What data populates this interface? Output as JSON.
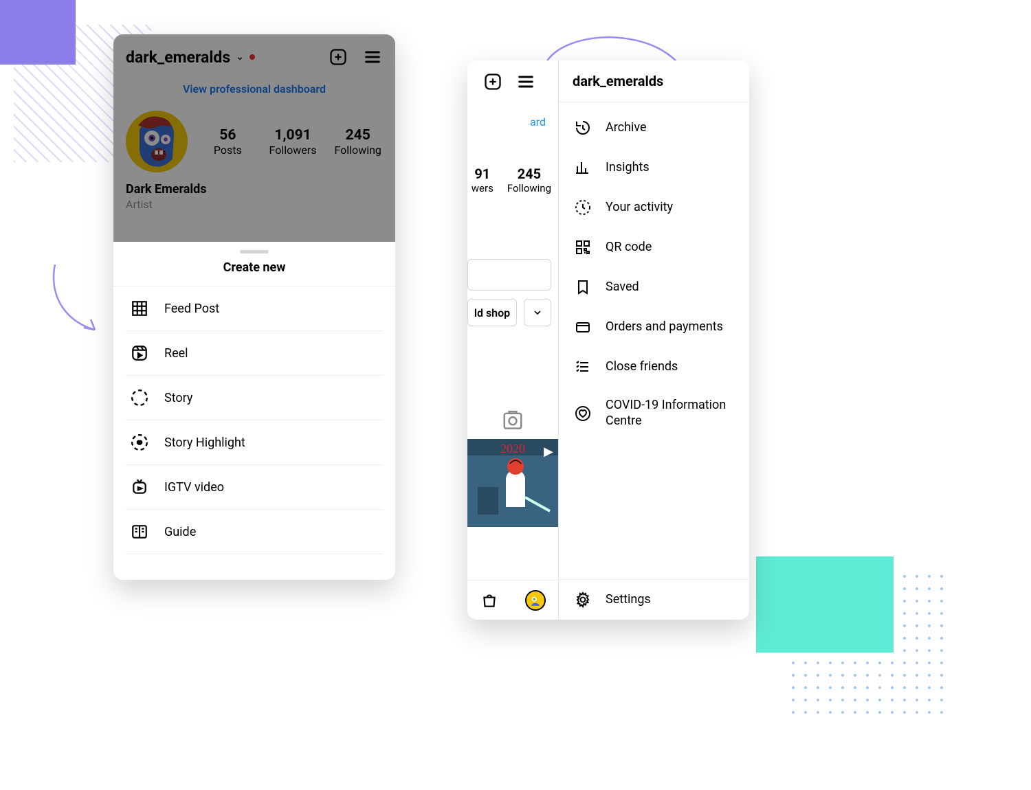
{
  "left": {
    "username": "dark_emeralds",
    "dashboard_link": "View professional dashboard",
    "stats": {
      "posts": {
        "value": "56",
        "label": "Posts"
      },
      "followers": {
        "value": "1,091",
        "label": "Followers"
      },
      "following": {
        "value": "245",
        "label": "Following"
      }
    },
    "bio": {
      "name": "Dark Emeralds",
      "category": "Artist"
    },
    "sheet": {
      "title": "Create new",
      "items": [
        {
          "label": "Feed Post",
          "icon": "grid-icon"
        },
        {
          "label": "Reel",
          "icon": "reel-icon"
        },
        {
          "label": "Story",
          "icon": "story-icon"
        },
        {
          "label": "Story Highlight",
          "icon": "highlight-icon"
        },
        {
          "label": "IGTV video",
          "icon": "igtv-icon"
        },
        {
          "label": "Guide",
          "icon": "guide-icon"
        }
      ]
    }
  },
  "right": {
    "username": "dark_emeralds",
    "dashboard_fragment": "ard",
    "stats_fragment": {
      "followers": {
        "value": "91",
        "label": "wers"
      },
      "following": {
        "value": "245",
        "label": "Following"
      }
    },
    "shop_fragment": "ld shop",
    "thumb_year": "2020",
    "drawer": {
      "items": [
        {
          "label": "Archive",
          "icon": "archive-icon"
        },
        {
          "label": "Insights",
          "icon": "insights-icon"
        },
        {
          "label": "Your activity",
          "icon": "activity-icon"
        },
        {
          "label": "QR code",
          "icon": "qrcode-icon"
        },
        {
          "label": "Saved",
          "icon": "saved-icon"
        },
        {
          "label": "Orders and payments",
          "icon": "card-icon"
        },
        {
          "label": "Close friends",
          "icon": "closefriends-icon"
        },
        {
          "label": "COVID-19 Information Centre",
          "icon": "heart-icon"
        }
      ],
      "footer": {
        "label": "Settings",
        "icon": "settings-icon"
      }
    }
  }
}
